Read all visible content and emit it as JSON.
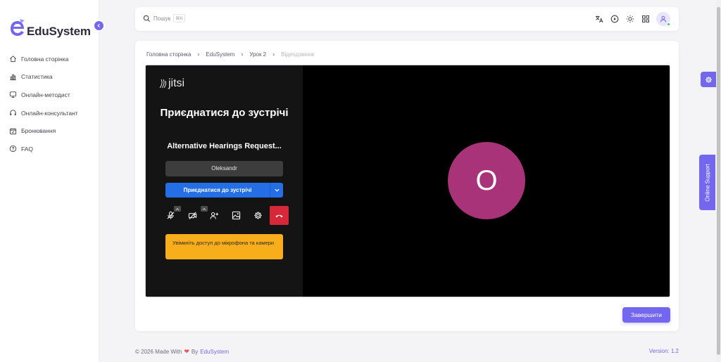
{
  "app": {
    "name": "EduSystem",
    "brand_color": "#7367f0"
  },
  "sidebar": {
    "items": [
      {
        "label": "Головна сторінка",
        "icon": "home-icon"
      },
      {
        "label": "Статистика",
        "icon": "bar-chart-icon"
      },
      {
        "label": "Онлайн-методист",
        "icon": "monitor-icon"
      },
      {
        "label": "Онлайн-консультант",
        "icon": "headphones-icon"
      },
      {
        "label": "Бронювання",
        "icon": "calendar-check-icon"
      },
      {
        "label": "FAQ",
        "icon": "help-circle-icon"
      }
    ]
  },
  "topbar": {
    "search_placeholder": "Пошук",
    "search_shortcut": "⌘K",
    "icons": [
      "translate-icon",
      "play-circle-icon",
      "sun-icon",
      "apps-grid-icon",
      "user-avatar-icon"
    ]
  },
  "breadcrumb": [
    "Головна сторінка",
    "EduSystem",
    "Урок 2",
    "Відеодзвінок"
  ],
  "jitsi": {
    "logo_text": "jitsi",
    "title": "Приєднатися до зустрічі",
    "room_name": "Alternative Hearings Request...",
    "name_value": "Oleksandr",
    "join_label": "Приєднатися до зустрічі",
    "warning": "Увімкніть доступ до мікрофона та камери",
    "avatar_letter": "O",
    "avatar_color": "#a83379",
    "hangup_color": "#d62839"
  },
  "actions": {
    "finish_label": "Завершити"
  },
  "footer": {
    "copyright": "© 2026 Made With",
    "by": "By",
    "link": "EduSystem",
    "version": "Version: 1.2"
  },
  "side_tabs": {
    "support_label": "Online Support"
  }
}
